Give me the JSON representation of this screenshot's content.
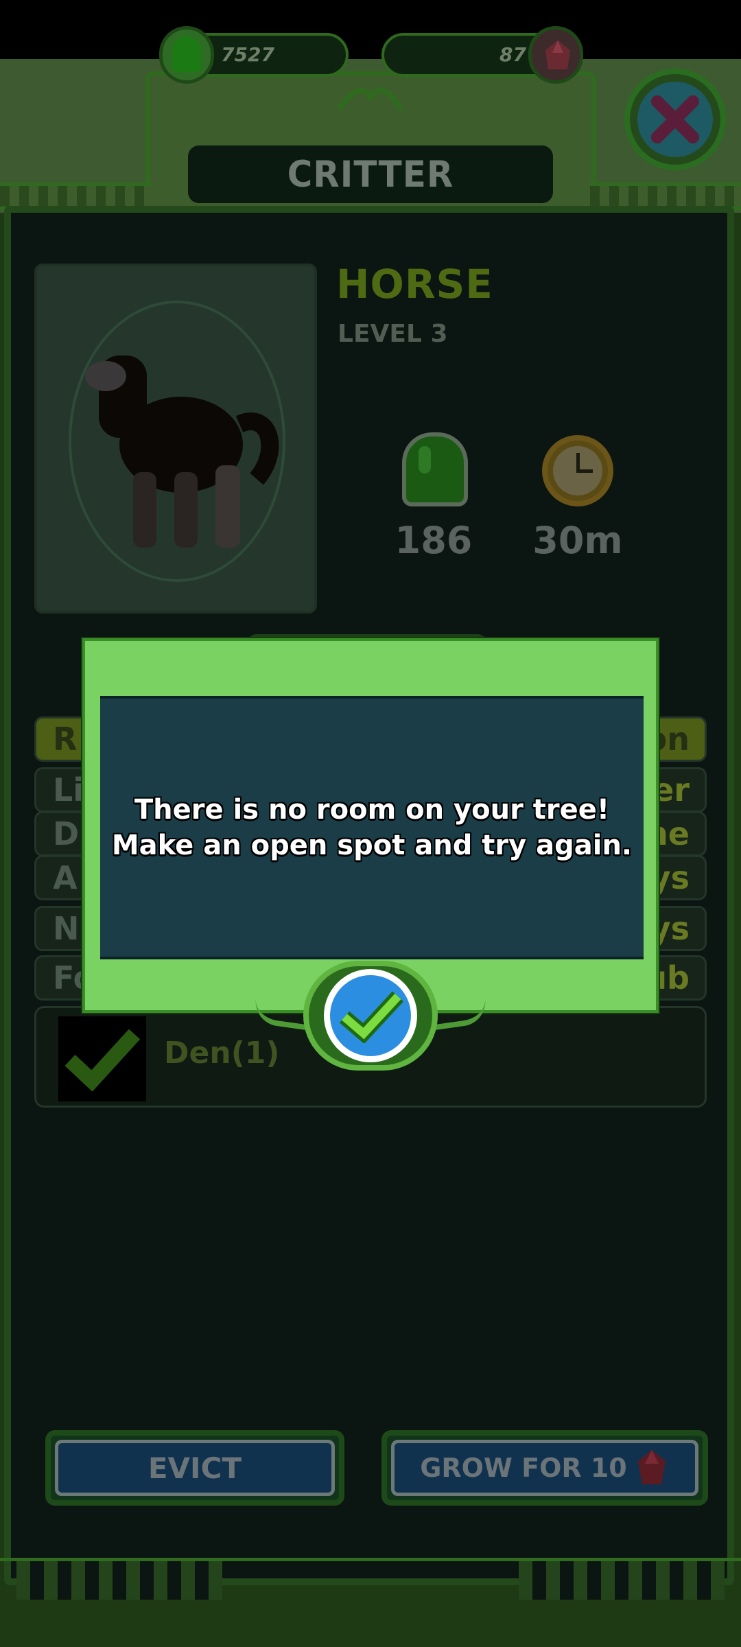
{
  "hud": {
    "gum_count": "7527",
    "gem_count": "87"
  },
  "screen": {
    "title": "CRITTER"
  },
  "critter": {
    "name": "HORSE",
    "level": "LEVEL 3",
    "gum_value": "186",
    "time_value": "30m"
  },
  "info_rows": [
    {
      "label": "R",
      "value": "on"
    },
    {
      "label": "Li",
      "value": "er"
    },
    {
      "label": "D",
      "value": "ne"
    },
    {
      "label": "A",
      "value": "ys"
    },
    {
      "label": "N",
      "value": "ys"
    },
    {
      "label": "Fo",
      "value": "ub"
    }
  ],
  "den": {
    "label": "Den(1)"
  },
  "buttons": {
    "evict": "EVICT",
    "grow": "GROW FOR 10"
  },
  "dialog": {
    "message_line1": "There is no room on your tree!",
    "message_line2": "Make an open spot and try again."
  },
  "colors": {
    "dialog_frame": "#79d261",
    "dialog_body": "#1a3d47",
    "ok_button": "#2b8ee0",
    "overlay_dim": "#0b1511"
  },
  "icons": {
    "gum": "green-gumdrop-icon",
    "gem": "red-gem-icon",
    "close": "close-x-icon",
    "clock": "clock-icon",
    "check": "checkmark-icon"
  }
}
